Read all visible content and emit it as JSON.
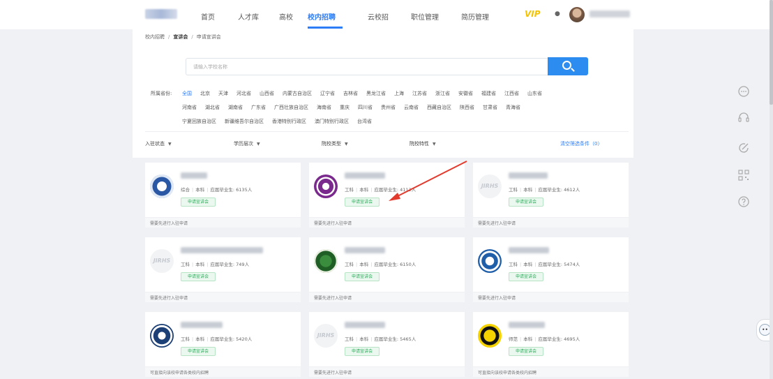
{
  "nav": {
    "items": [
      "首页",
      "人才库",
      "高校",
      "校内招聘",
      "云校招",
      "职位管理",
      "简历管理"
    ],
    "active": "校内招聘",
    "vip_label": "VIP"
  },
  "breadcrumb": {
    "root": "校内招聘",
    "section": "宣讲会",
    "current": "申请宣讲会"
  },
  "search": {
    "placeholder": "请输入学校名称"
  },
  "province": {
    "label": "所属省份:",
    "row1": [
      "全国",
      "北京",
      "天津",
      "河北省",
      "山西省",
      "内蒙古自治区",
      "辽宁省",
      "吉林省",
      "黑龙江省",
      "上海",
      "江苏省",
      "浙江省",
      "安徽省",
      "福建省",
      "江西省",
      "山东省"
    ],
    "row2": [
      "河南省",
      "湖北省",
      "湖南省",
      "广东省",
      "广西壮族自治区",
      "海南省",
      "重庆",
      "四川省",
      "贵州省",
      "云南省",
      "西藏自治区",
      "陕西省",
      "甘肃省",
      "青海省"
    ],
    "row3": [
      "宁夏回族自治区",
      "新疆维吾尔自治区",
      "香港特别行政区",
      "澳门特别行政区",
      "台湾省"
    ],
    "active": "全国"
  },
  "filters": {
    "status": "入驻状态",
    "degree": "学历层次",
    "school_type": "院校类型",
    "school_feature": "院校特性",
    "clear": "清空筛选条件（0）"
  },
  "cards": [
    {
      "emblem": "blue-emblem",
      "meta_type": "综合",
      "meta_level": "本科",
      "meta_grads": "应届毕业生: 6135人",
      "tag": "申请宣讲会",
      "footer": "需要先进行入驻申请"
    },
    {
      "emblem": "purple-emblem",
      "meta_type": "工科",
      "meta_level": "本科",
      "meta_grads": "应届毕业生: 4112人",
      "tag": "申请宣讲会",
      "footer": "需要先进行入驻申请"
    },
    {
      "emblem": "placeholder-emblem",
      "meta_type": "工科",
      "meta_level": "本科",
      "meta_grads": "应届毕业生: 4612人",
      "tag": "申请宣讲会",
      "footer": "需要先进行入驻申请"
    },
    {
      "emblem": "placeholder-emblem",
      "meta_type": "工科",
      "meta_level": "本科",
      "meta_grads": "应届毕业生: 749人",
      "tag": "申请宣讲会",
      "footer": "需要先进行入驻申请"
    },
    {
      "emblem": "green-emblem",
      "meta_type": "工科",
      "meta_level": "本科",
      "meta_grads": "应届毕业生: 6150人",
      "tag": "申请宣讲会",
      "footer": "需要先进行入驻申请"
    },
    {
      "emblem": "wave-emblem",
      "meta_type": "工科",
      "meta_level": "本科",
      "meta_grads": "应届毕业生: 5474人",
      "tag": "申请宣讲会",
      "footer": "需要先进行入驻申请"
    },
    {
      "emblem": "navy-emblem",
      "meta_type": "工科",
      "meta_level": "本科",
      "meta_grads": "应届毕业生: 5420人",
      "tag": "申请宣讲会",
      "footer": "可直接向该校申请各类校内招聘"
    },
    {
      "emblem": "placeholder-emblem",
      "meta_type": "工科",
      "meta_level": "本科",
      "meta_grads": "应届毕业生: 5465人",
      "tag": "申请宣讲会",
      "footer": "需要先进行入驻申请"
    },
    {
      "emblem": "gold-emblem",
      "meta_type": "师范",
      "meta_level": "本科",
      "meta_grads": "应届毕业生: 4695人",
      "tag": "申请宣讲会",
      "footer": "可直接向该校申请各类校内招聘"
    }
  ],
  "placeholder_logo_text": "JIRHS",
  "right_toolbar": [
    "chat-bubble-icon",
    "headset-icon",
    "feedback-icon",
    "qrcode-icon",
    "help-icon"
  ],
  "colors": {
    "accent": "#2d7df6",
    "tag_green": "#2eae5c",
    "vip": "#f5c300",
    "annotation_arrow": "#e23b2e"
  }
}
